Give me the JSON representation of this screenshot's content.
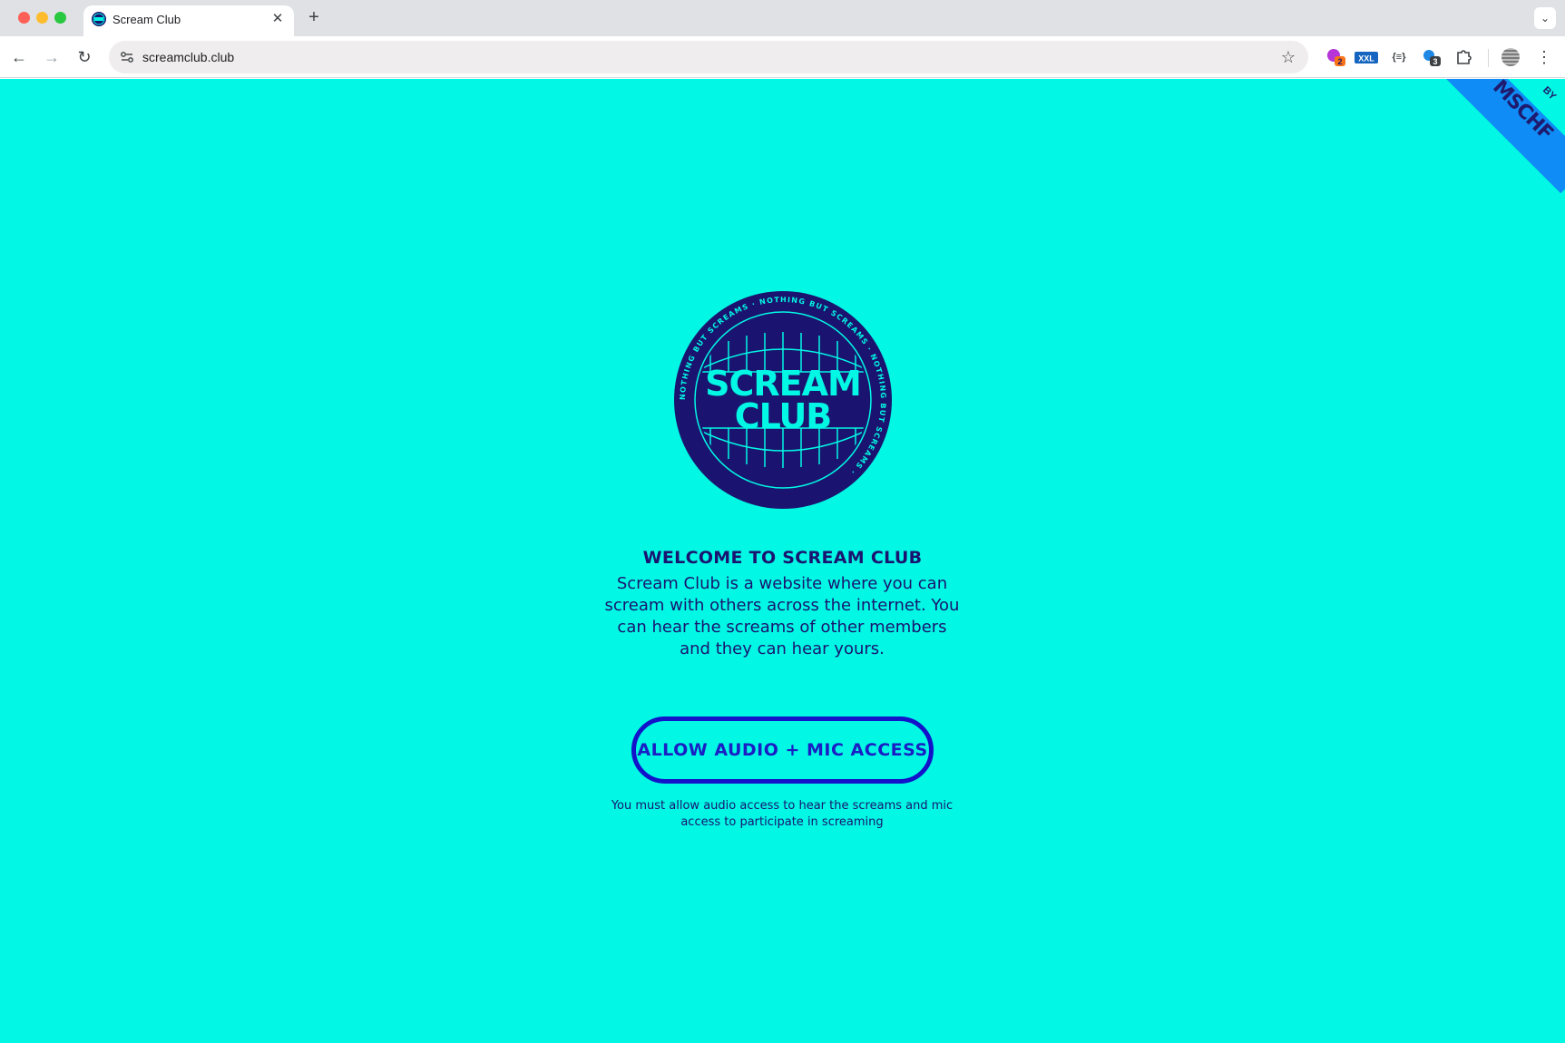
{
  "browser": {
    "tab_title": "Scream Club",
    "url": "screamclub.club",
    "extensions": [
      {
        "name": "extension-puzzle-badge",
        "badge": "2"
      },
      {
        "name": "xxl-extension",
        "label": "XXL"
      },
      {
        "name": "json-extension",
        "label": "{≡}"
      },
      {
        "name": "password-extension",
        "badge": "3"
      }
    ]
  },
  "page": {
    "background_color": "#02f8e4",
    "ribbon": {
      "by_label": "BY",
      "logo_text": "MSCHF"
    },
    "badge": {
      "ring_text": "NOTHING BUT SCREAMS · NOTHING BUT SCREAMS · NOTHING BUT SCREAMS ·",
      "line1": "SCREAM",
      "line2": "CLUB"
    },
    "welcome_title": "WELCOME TO SCREAM CLUB",
    "welcome_text": "Scream Club is a website where you can scream with others across the internet. You can hear the screams of other members and they can hear yours.",
    "allow_button": "ALLOW AUDIO + MIC ACCESS",
    "hint_text": "You must allow audio access to hear the screams and mic access to participate in screaming"
  },
  "colors": {
    "accent_dark": "#1a1470",
    "button_blue": "#1313c9",
    "ribbon_blue": "#0f8cf5"
  }
}
